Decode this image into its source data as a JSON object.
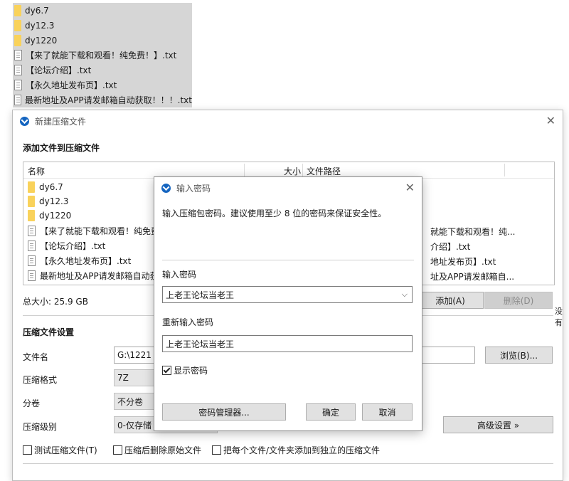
{
  "desktop_items": [
    {
      "name": "dy6.7",
      "type": "folder"
    },
    {
      "name": "dy12.3",
      "type": "folder"
    },
    {
      "name": "dy1220",
      "type": "folder"
    },
    {
      "name": "【来了就能下载和观看！纯免费！】.txt",
      "type": "file"
    },
    {
      "name": "【论坛介绍】.txt",
      "type": "file"
    },
    {
      "name": "【永久地址发布页】.txt",
      "type": "file"
    },
    {
      "name": "最新地址及APP请发邮箱自动获取！！！.txt",
      "type": "file"
    }
  ],
  "main_dialog": {
    "title": "新建压缩文件",
    "add_section_title": "添加文件到压缩文件",
    "columns": {
      "name": "名称",
      "size": "大小",
      "path": "文件路径"
    },
    "rows": [
      {
        "name": "dy6.7",
        "type": "folder",
        "path": ""
      },
      {
        "name": "dy12.3",
        "type": "folder",
        "path": ""
      },
      {
        "name": "dy1220",
        "type": "folder",
        "path": ""
      },
      {
        "name": "【来了就能下载和观看！纯免费",
        "type": "file",
        "path": "就能下载和观看！纯..."
      },
      {
        "name": "【论坛介绍】.txt",
        "type": "file",
        "path": "介绍】.txt"
      },
      {
        "name": "【永久地址发布页】.txt",
        "type": "file",
        "path": "地址发布页】.txt"
      },
      {
        "name": "最新地址及APP请发邮箱自动获",
        "type": "file",
        "path": "址及APP请发邮箱自..."
      }
    ],
    "total_size": "总大小: 25.9 GB",
    "add_button": "添加(A)",
    "delete_button": "删除(D)",
    "settings_title": "压缩文件设置",
    "filename_label": "文件名",
    "filename_value": "G:\\1221 (",
    "browse_button": "浏览(B)...",
    "format_label": "压缩格式",
    "format_value": "7Z",
    "split_label": "分卷",
    "split_value": "不分卷",
    "level_label": "压缩级别",
    "level_value": "0-仅存储",
    "advanced_button": "高级设置 »",
    "checkboxes": [
      {
        "label": "测试压缩文件(T)",
        "checked": false
      },
      {
        "label": "压缩后删除原始文件",
        "checked": false
      },
      {
        "label": "把每个文件/文件夹添加到独立的压缩文件",
        "checked": false
      }
    ],
    "edge_text": "没有"
  },
  "password_dialog": {
    "title": "输入密码",
    "instruction": "输入压缩包密码。建议使用至少 8 位的密码来保证安全性。",
    "enter_label": "输入密码",
    "enter_value": "上老王论坛当老王",
    "reenter_label": "重新输入密码",
    "reenter_value": "上老王论坛当老王",
    "show_password_label": "显示密码",
    "show_password_checked": true,
    "manager_button": "密码管理器...",
    "ok_button": "确定",
    "cancel_button": "取消"
  },
  "colors": {
    "selection_gray": "#d6d6d6",
    "folder_yellow": "#f9d25b",
    "app_blue": "#1565c0"
  }
}
